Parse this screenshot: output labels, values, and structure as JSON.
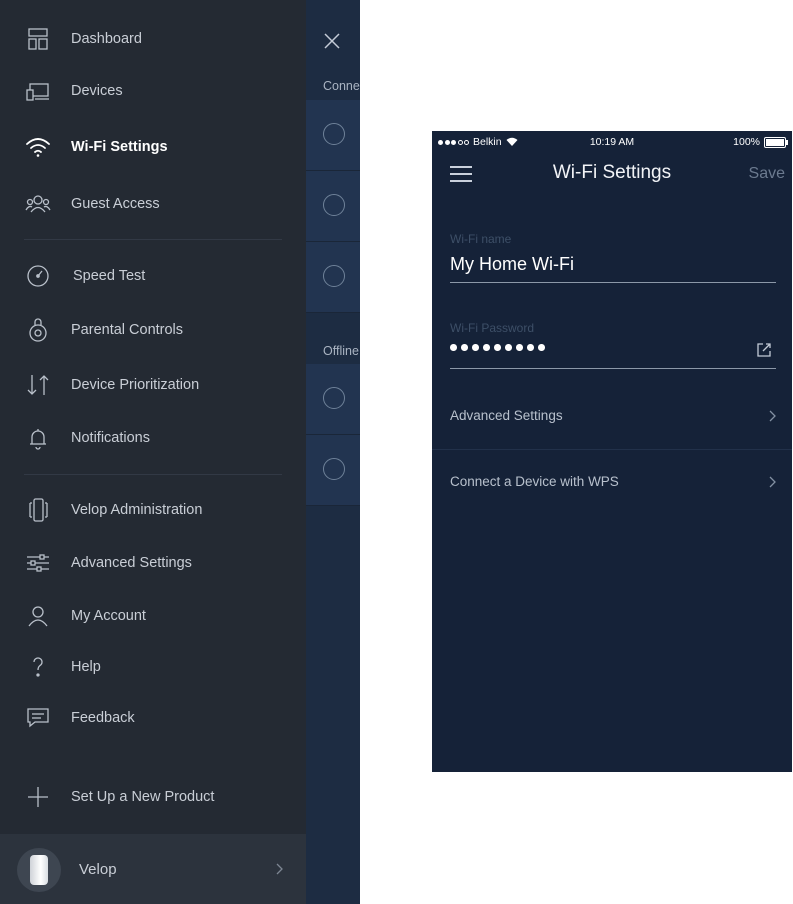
{
  "side_menu": {
    "items": [
      {
        "label": "Dashboard",
        "icon": "dashboard-icon"
      },
      {
        "label": "Devices",
        "icon": "devices-icon"
      },
      {
        "label": "Wi-Fi Settings",
        "icon": "wifi-icon",
        "active": true
      },
      {
        "label": "Guest Access",
        "icon": "guest-access-icon"
      },
      {
        "label": "Speed Test",
        "icon": "speedometer-icon"
      },
      {
        "label": "Parental Controls",
        "icon": "parental-controls-icon"
      },
      {
        "label": "Device Prioritization",
        "icon": "prioritization-arrows-icon"
      },
      {
        "label": "Notifications",
        "icon": "bell-icon"
      },
      {
        "label": "Velop Administration",
        "icon": "velop-node-icon"
      },
      {
        "label": "Advanced Settings",
        "icon": "sliders-icon"
      },
      {
        "label": "My Account",
        "icon": "user-icon"
      },
      {
        "label": "Help",
        "icon": "question-icon"
      },
      {
        "label": "Feedback",
        "icon": "chat-icon"
      },
      {
        "label": "Set Up a New Product",
        "icon": "plus-icon"
      }
    ],
    "footer": {
      "label": "Velop",
      "icon": "velop-device-icon"
    }
  },
  "behind_panel": {
    "connected_label": "Conne",
    "offline_label": "Offline"
  },
  "phone": {
    "status_bar": {
      "carrier": "Belkin",
      "time": "10:19 AM",
      "battery": "100%"
    },
    "nav": {
      "title": "Wi-Fi Settings",
      "save_label": "Save"
    },
    "wifi_name": {
      "label": "Wi-Fi name",
      "value": "My Home Wi-Fi"
    },
    "wifi_password": {
      "label": "Wi-Fi Password"
    },
    "rows": [
      {
        "label": "Advanced Settings"
      },
      {
        "label": "Connect a Device with WPS"
      }
    ],
    "colors": {
      "background": "#152238",
      "accent_muted": "#6b7a8f"
    }
  }
}
